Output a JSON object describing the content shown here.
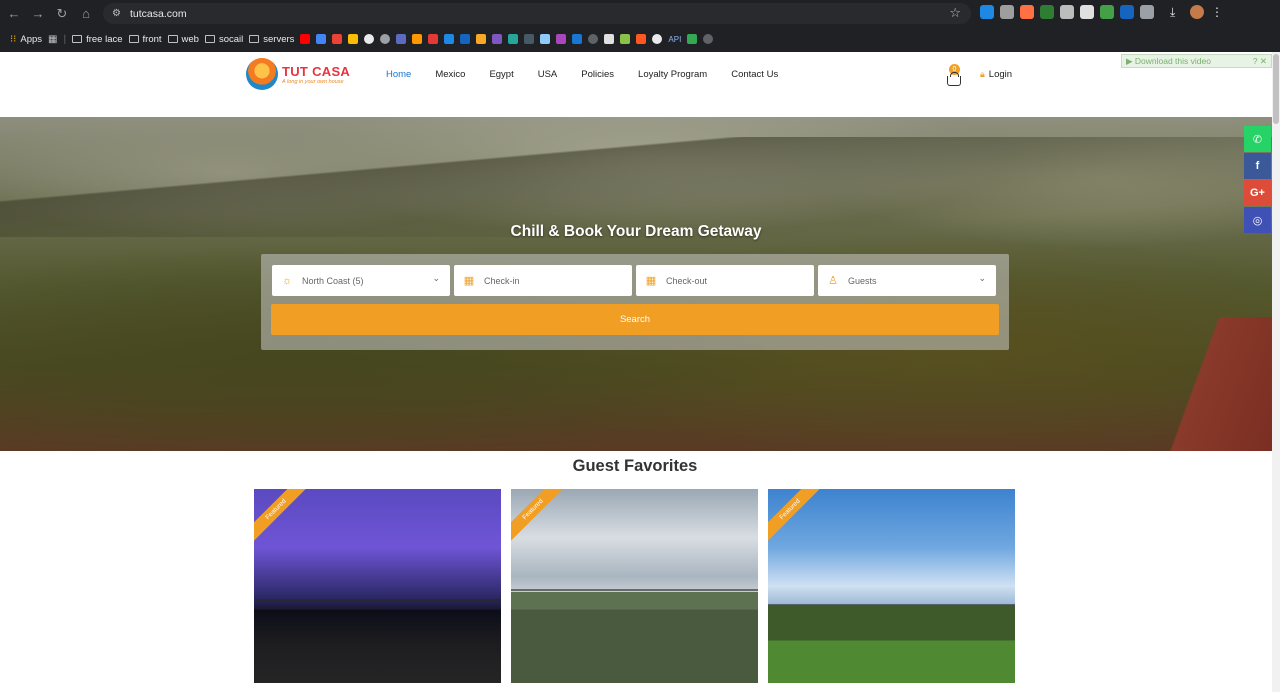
{
  "browser": {
    "url": "tutcasa.com",
    "bookmarks": [
      "Apps",
      "free lace",
      "front",
      "web",
      "socail",
      "servers"
    ],
    "bookmark_api_label": "API",
    "colors": {
      "chrome_bg": "#202124",
      "omnibox_bg": "#282a2d"
    }
  },
  "header": {
    "logo_name": "TUT CASA",
    "logo_tagline": "A long in your own house",
    "nav": [
      "Home",
      "Mexico",
      "Egypt",
      "USA",
      "Policies",
      "Loyalty Program",
      "Contact Us"
    ],
    "active_nav": "Home",
    "cart_count": "0",
    "login_label": "Login",
    "download_video_label": "▶ Download this video",
    "download_help": "?",
    "download_close": "✕"
  },
  "hero": {
    "title": "Chill & Book Your Dream Getaway",
    "destination_value": "North Coast (5)",
    "checkin_placeholder": "Check-in",
    "checkout_placeholder": "Check-out",
    "guests_placeholder": "Guests",
    "search_label": "Search"
  },
  "social": [
    {
      "name": "whatsapp",
      "glyph": "✆",
      "color": "#25d366"
    },
    {
      "name": "facebook",
      "glyph": "f",
      "color": "#3b5998"
    },
    {
      "name": "google-plus",
      "glyph": "G+",
      "color": "#dd4b39"
    },
    {
      "name": "instagram",
      "glyph": "◎",
      "color": "#3f51b5"
    }
  ],
  "favorites": {
    "title": "Guest Favorites",
    "cards": [
      {
        "ribbon": "Featured"
      },
      {
        "ribbon": "Featured"
      },
      {
        "ribbon": "Featured"
      }
    ]
  },
  "colors": {
    "accent": "#f09e24",
    "link_active": "#1976d2",
    "brand_red": "#e8343e"
  }
}
